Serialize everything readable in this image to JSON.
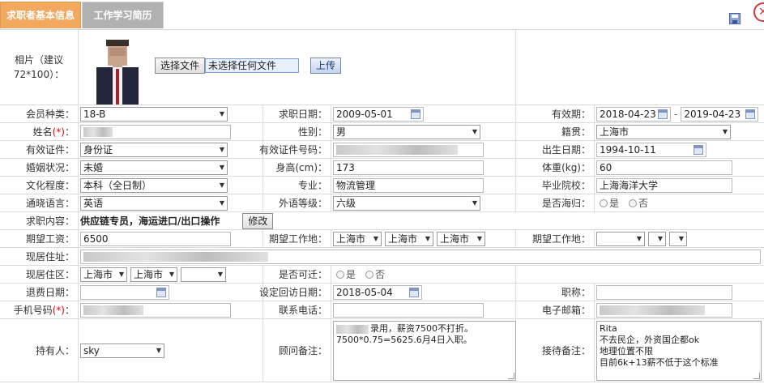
{
  "tabs": {
    "active": "求职者基本信息",
    "inactive": "工作学习简历"
  },
  "photo": {
    "label": "相片（建议72*100）：",
    "choose_btn": "选择文件",
    "no_file": "未选择任何文件",
    "upload_btn": "上传"
  },
  "r1": {
    "l1": "会员种类：",
    "v1": "18-B",
    "l2": "求职日期：",
    "v2": "2009-05-01",
    "l3": "有效期：",
    "v3a": "2018-04-23",
    "sep": "-",
    "v3b": "2019-04-23"
  },
  "r2": {
    "l1": "姓名",
    "req": "(*)",
    "colon": "：",
    "l2": "性别：",
    "v2": "男",
    "l3": "籍贯：",
    "v3": "上海市"
  },
  "r3": {
    "l1": "有效证件：",
    "v1": "身份证",
    "l2": "有效证件号码：",
    "l3": "出生日期：",
    "v3": "1994-10-11"
  },
  "r4": {
    "l1": "婚姻状况：",
    "v1": "未婚",
    "l2": "身高(cm)：",
    "v2": "173",
    "l3": "体重(kg)：",
    "v3": "60"
  },
  "r5": {
    "l1": "文化程度：",
    "v1": "本科（全日制）",
    "l2": "专业：",
    "v2": "物流管理",
    "l3": "毕业院校：",
    "v3": "上海海洋大学"
  },
  "r6": {
    "l1": "通晓语言：",
    "v1": "英语",
    "l2": "外语等级：",
    "v2": "六级",
    "l3": "是否海归：",
    "yes": "是",
    "no": "否"
  },
  "r7": {
    "l1": "求职内容：",
    "v1": "供应链专员，海运进口/出口操作",
    "btn": "修改"
  },
  "r8": {
    "l1": "期望工资：",
    "v1": "6500",
    "l2": "期望工作地：",
    "a": "上海市",
    "b": "上海市",
    "c": "上海市",
    "l3": "期望工作地："
  },
  "r9": {
    "l1": "现居住址："
  },
  "r10": {
    "l1": "现居住区：",
    "a": "上海市",
    "b": "上海市",
    "l2": "是否可迁：",
    "yes": "是",
    "no": "否"
  },
  "r11": {
    "l1": "退费日期：",
    "l2": "设定回访日期：",
    "v2": "2018-05-04",
    "l3": "职称："
  },
  "r12": {
    "l1": "手机号码",
    "req": "(*)",
    "colon": "：",
    "l2": "联系电话：",
    "l3": "电子邮箱："
  },
  "r13": {
    "l1": "持有人：",
    "v1": "sky",
    "l2": "顾问备注：",
    "v2": "录用，薪资7500不打折。\n7500*0.75=5625.6月4日入职。",
    "l3": "接待备注：",
    "v3": "Rita\n不去民企，外资国企都ok\n地理位置不限\n目前6k+13薪不低于这个标准"
  },
  "colors": {
    "tab_active": "#f3a860",
    "tab_inactive": "#b1b1b1",
    "required": "#dd0000",
    "close": "#d03a3a"
  },
  "icons": {
    "save": "save-icon",
    "close": "close-icon",
    "calendar": "calendar-icon"
  }
}
